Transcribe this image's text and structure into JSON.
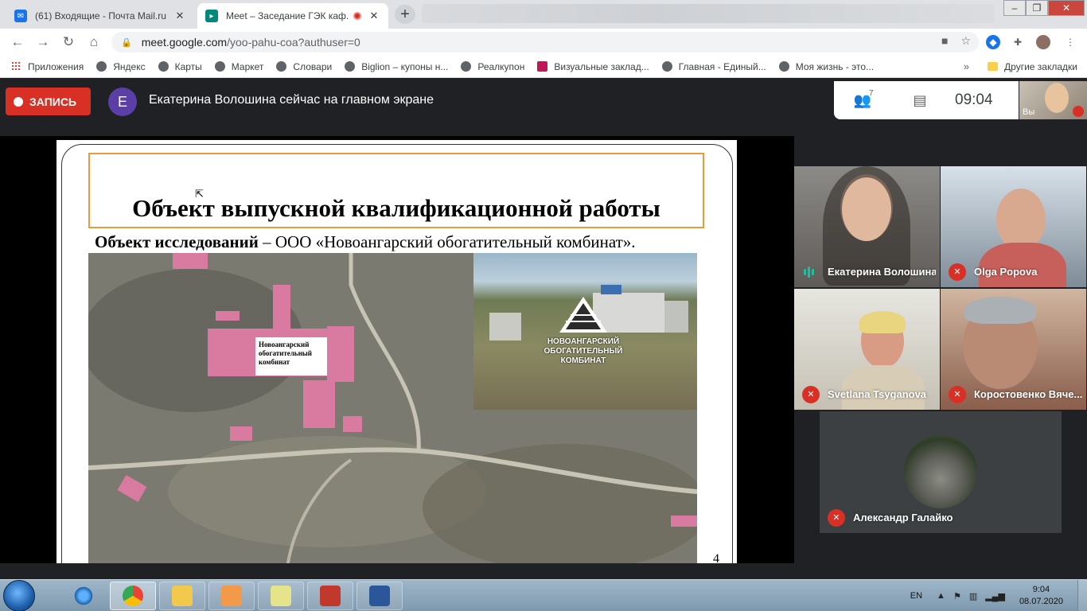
{
  "browser": {
    "tabs": [
      {
        "title": "(61) Входящие - Почта Mail.ru",
        "active": false
      },
      {
        "title": "Meet – Заседание ГЭК каф.",
        "active": true
      }
    ],
    "new_tab_label": "+",
    "url_host": "meet.google.com",
    "url_path": "/yoo-pahu-coa?authuser=0",
    "bookmarks": [
      {
        "label": "Приложения"
      },
      {
        "label": "Яндекс"
      },
      {
        "label": "Карты"
      },
      {
        "label": "Маркет"
      },
      {
        "label": "Словари"
      },
      {
        "label": "Biglion – купоны н..."
      },
      {
        "label": "Реалкупон"
      },
      {
        "label": "Визуальные заклад..."
      },
      {
        "label": "Главная - Единый..."
      },
      {
        "label": "Моя жизнь - это..."
      }
    ],
    "bookmarks_more": "»",
    "other_bookmarks": "Другие закладки"
  },
  "meet": {
    "record_label": "ЗАПИСЬ",
    "presenter_initial": "E",
    "presenter_message": "Екатерина Волошина сейчас на главном экране",
    "participants_count": "7",
    "time": "09:04",
    "self_label": "Вы"
  },
  "slide": {
    "title": "Объект выпускной квалификационной работы",
    "subtitle_bold": "Объект исследований",
    "subtitle_rest": " – ООО «Новоангарский обогатительный комбинат».",
    "map_label": "Новоангарский обогатительный комбинат",
    "logo_text": [
      "НОВОАНГАРСКИЙ",
      "ОБОГАТИТЕЛЬНЫЙ",
      "КОМБИНАТ"
    ],
    "page_number": "4"
  },
  "participants": [
    {
      "name": "Екатерина Волошина",
      "muted": false
    },
    {
      "name": "Olga Popova",
      "muted": true
    },
    {
      "name": "Svetlana Tsyganova",
      "muted": true
    },
    {
      "name": "Коростовенко Вяче...",
      "muted": true
    },
    {
      "name": "Александр Галайко",
      "muted": true
    }
  ],
  "taskbar": {
    "language": "EN",
    "clock_time": "9:04",
    "clock_date": "08.07.2020"
  },
  "colors": {
    "record_red": "#d93025",
    "speaking_teal": "#1ac0a3",
    "title_border": "#e69b3c",
    "presenter_avatar": "#5b3fa6"
  }
}
